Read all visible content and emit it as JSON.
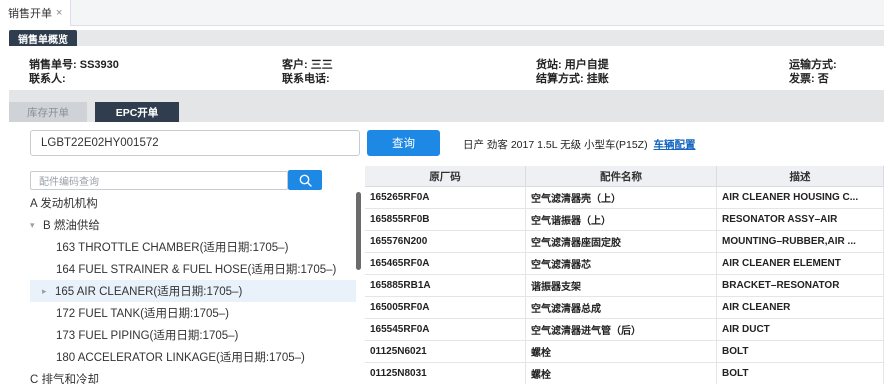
{
  "tab": {
    "title": "销售开单",
    "close_icon": "×"
  },
  "section": {
    "title": "销售单概览"
  },
  "order": {
    "number_label": "销售单号:",
    "number_value": "SS3930",
    "contact_label": "联系人:",
    "contact_value": "",
    "customer_label": "客户:",
    "customer_value": "三三",
    "phone_label": "联系电话:",
    "phone_value": "",
    "store_label": "货站:",
    "store_value": "用户自提",
    "settle_label": "结算方式:",
    "settle_value": "挂账",
    "shipping_label": "运输方式:",
    "shipping_value": "",
    "invoice_label": "发票:",
    "invoice_value": "否"
  },
  "subtabs": {
    "stock": "库存开单",
    "epc": "EPC开单"
  },
  "vin": {
    "value": "LGBT22E02HY001572",
    "query_label": "查询"
  },
  "vehicle": {
    "description": "日产 劲客 2017 1.5L 无级 小型车(P15Z)",
    "config_link": "车辆配置"
  },
  "part_search": {
    "placeholder": "配件编码查询"
  },
  "tree": [
    {
      "label": "A 发动机机构",
      "level": 0,
      "arrow": ""
    },
    {
      "label": "B 燃油供给",
      "level": 0,
      "arrow": "▾"
    },
    {
      "label": "163 THROTTLE CHAMBER(适用日期:1705–)",
      "level": 1,
      "arrow": ""
    },
    {
      "label": "164 FUEL STRAINER & FUEL HOSE(适用日期:1705–)",
      "level": 1,
      "arrow": ""
    },
    {
      "label": "165 AIR CLEANER(适用日期:1705–)",
      "level": 1,
      "arrow": "▸",
      "selected": true
    },
    {
      "label": "172 FUEL TANK(适用日期:1705–)",
      "level": 1,
      "arrow": ""
    },
    {
      "label": "173 FUEL PIPING(适用日期:1705–)",
      "level": 1,
      "arrow": ""
    },
    {
      "label": "180 ACCELERATOR LINKAGE(适用日期:1705–)",
      "level": 1,
      "arrow": ""
    },
    {
      "label": "C 排气和冷却",
      "level": 0,
      "arrow": ""
    }
  ],
  "table": {
    "headers": [
      "原厂码",
      "配件名称",
      "描述"
    ],
    "rows": [
      [
        "165265RF0A",
        "空气滤清器壳（上）",
        "AIR CLEANER HOUSING C..."
      ],
      [
        "165855RF0B",
        "空气谐振器（上）",
        "RESONATOR ASSY–AIR"
      ],
      [
        "165576N200",
        "空气滤清器座固定胶",
        "MOUNTING–RUBBER,AIR ..."
      ],
      [
        "165465RF0A",
        "空气滤清器芯",
        "AIR CLEANER ELEMENT"
      ],
      [
        "165885RB1A",
        "谐振器支架",
        "BRACKET–RESONATOR"
      ],
      [
        "165005RF0A",
        "空气滤清器总成",
        "AIR CLEANER"
      ],
      [
        "165545RF0A",
        "空气滤清器进气管（后）",
        "AIR DUCT"
      ],
      [
        "01125N6021",
        "螺栓",
        "BOLT"
      ],
      [
        "01125N8031",
        "螺栓",
        "BOLT"
      ]
    ]
  },
  "colors": {
    "accent": "#1e88e5",
    "dark": "#2f3d4f",
    "link": "#1565c0"
  }
}
